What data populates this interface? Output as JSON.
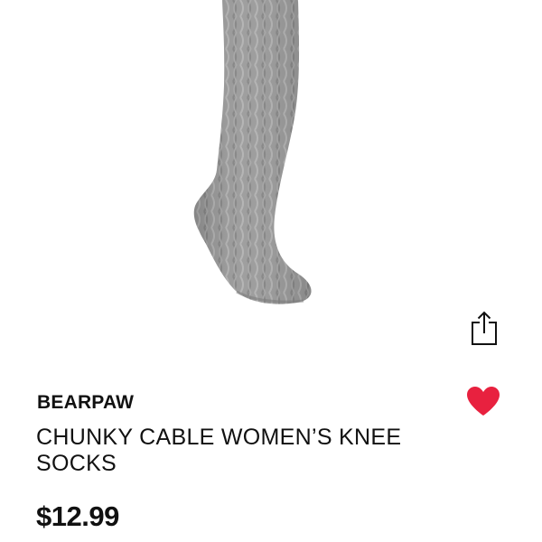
{
  "product": {
    "brand": "BEARPAW",
    "title": "CHUNKY CABLE WOMEN’S KNEE SOCKS",
    "price": "$12.99",
    "image_alt": "Gray chunky cable knit knee sock"
  },
  "actions": {
    "share_icon": "share-icon",
    "favorite_icon": "heart-icon",
    "favorite_color": "#e8213f"
  }
}
